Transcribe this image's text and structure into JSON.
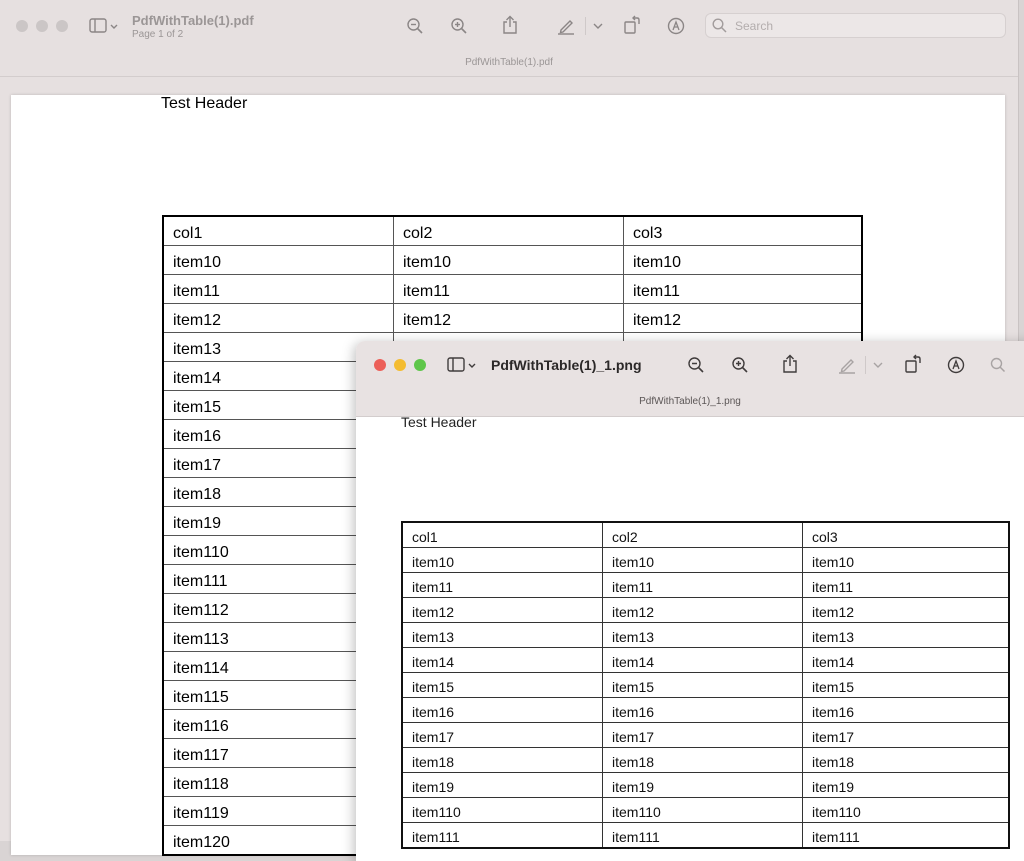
{
  "back_window": {
    "title": "PdfWithTable(1).pdf",
    "subtitle": "Page 1 of 2",
    "caption": "PdfWithTable(1).pdf",
    "search_placeholder": "Search",
    "document": {
      "header": "Test Header",
      "table": {
        "columns": [
          "col1",
          "col2",
          "col3"
        ],
        "rows": [
          [
            "item10",
            "item10",
            "item10"
          ],
          [
            "item11",
            "item11",
            "item11"
          ],
          [
            "item12",
            "item12",
            "item12"
          ],
          [
            "item13",
            "",
            ""
          ],
          [
            "item14",
            "",
            ""
          ],
          [
            "item15",
            "",
            ""
          ],
          [
            "item16",
            "",
            ""
          ],
          [
            "item17",
            "",
            ""
          ],
          [
            "item18",
            "",
            ""
          ],
          [
            "item19",
            "",
            ""
          ],
          [
            "item110",
            "",
            ""
          ],
          [
            "item111",
            "",
            ""
          ],
          [
            "item112",
            "",
            ""
          ],
          [
            "item113",
            "",
            ""
          ],
          [
            "item114",
            "",
            ""
          ],
          [
            "item115",
            "",
            ""
          ],
          [
            "item116",
            "",
            ""
          ],
          [
            "item117",
            "",
            ""
          ],
          [
            "item118",
            "",
            ""
          ],
          [
            "item119",
            "",
            ""
          ],
          [
            "item120",
            "",
            ""
          ]
        ]
      }
    }
  },
  "front_window": {
    "title": "PdfWithTable(1)_1.png",
    "caption": "PdfWithTable(1)_1.png",
    "document": {
      "header": "Test Header",
      "table": {
        "columns": [
          "col1",
          "col2",
          "col3"
        ],
        "rows": [
          [
            "item10",
            "item10",
            "item10"
          ],
          [
            "item11",
            "item11",
            "item11"
          ],
          [
            "item12",
            "item12",
            "item12"
          ],
          [
            "item13",
            "item13",
            "item13"
          ],
          [
            "item14",
            "item14",
            "item14"
          ],
          [
            "item15",
            "item15",
            "item15"
          ],
          [
            "item16",
            "item16",
            "item16"
          ],
          [
            "item17",
            "item17",
            "item17"
          ],
          [
            "item18",
            "item18",
            "item18"
          ],
          [
            "item19",
            "item19",
            "item19"
          ],
          [
            "item110",
            "item110",
            "item110"
          ],
          [
            "item111",
            "item111",
            "item111"
          ]
        ]
      }
    }
  },
  "icons": {
    "sidebar": "sidebar-icon",
    "zoom_out": "zoom-out-icon",
    "zoom_in": "zoom-in-icon",
    "share": "share-icon",
    "markup": "markup-pen-icon",
    "rotate": "rotate-icon",
    "annotate": "annotate-circle-icon",
    "search": "search-icon"
  },
  "colors": {
    "close": "#ec5f58",
    "minimize": "#f4bc30",
    "zoom": "#5ec64a",
    "toolbar_bg": "#e6e0e0"
  }
}
